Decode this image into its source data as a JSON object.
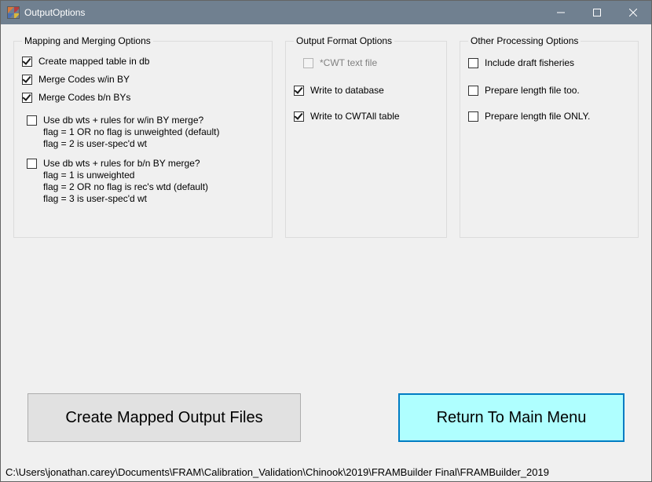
{
  "window": {
    "title": "OutputOptions"
  },
  "groups": {
    "mapping": {
      "legend": "Mapping and Merging Options",
      "create_table": "Create mapped table in db",
      "merge_win": "Merge Codes w/in BY",
      "merge_bn": "Merge Codes b/n BYs",
      "wts_win": "Use db wts + rules for w/in BY merge?\n flag = 1 OR no flag is unweighted (default)\n flag = 2 is user-spec'd wt",
      "wts_bn": "Use db wts + rules for b/n BY merge?\n flag = 1 is unweighted\n flag = 2 OR no flag is rec's wtd (default)\n flag = 3 is user-spec'd wt"
    },
    "output": {
      "legend": "Output Format Options",
      "cwt_text": "*CWT text file",
      "write_db": "Write to database",
      "write_cwtall": "Write to CWTAll table"
    },
    "other": {
      "legend": "Other Processing Options",
      "draft": "Include draft fisheries",
      "len_too": "Prepare length file too.",
      "len_only": "Prepare length file ONLY."
    }
  },
  "buttons": {
    "create": "Create Mapped Output Files",
    "return_main": "Return To Main Menu"
  },
  "path": "C:\\Users\\jonathan.carey\\Documents\\FRAM\\Calibration_Validation\\Chinook\\2019\\FRAMBuilder Final\\FRAMBuilder_2019"
}
